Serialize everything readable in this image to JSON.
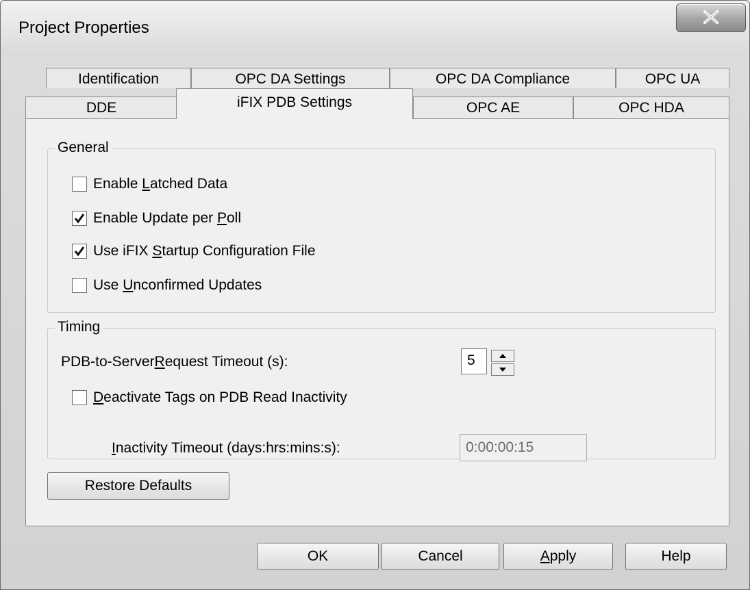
{
  "window": {
    "title": "Project Properties"
  },
  "tabs_row1": [
    "Identification",
    "OPC DA Settings",
    "OPC DA Compliance",
    "OPC UA"
  ],
  "tabs_row2": [
    "DDE",
    "iFIX PDB Settings",
    "OPC AE",
    "OPC HDA"
  ],
  "active_tab": "iFIX PDB Settings",
  "general": {
    "legend": "General",
    "options": [
      {
        "pre": "Enable ",
        "key": "L",
        "post": "atched Data",
        "checked": false
      },
      {
        "pre": "Enable Update per ",
        "key": "P",
        "post": "oll",
        "checked": true
      },
      {
        "pre": "Use iFIX ",
        "key": "S",
        "post": "tartup Configuration File",
        "checked": true
      },
      {
        "pre": "Use ",
        "key": "U",
        "post": "nconfirmed Updates",
        "checked": false
      }
    ]
  },
  "timing": {
    "legend": "Timing",
    "request_timeout": {
      "pre": "PDB-to-Server ",
      "key": "R",
      "post": "equest Timeout (s):",
      "value": "5"
    },
    "deactivate": {
      "pre": "",
      "key": "D",
      "post": "eactivate Tags on PDB Read Inactivity",
      "checked": false
    },
    "inactivity": {
      "pre": "",
      "key": "I",
      "post": "nactivity Timeout (days:hrs:mins:s):",
      "value": "0:00:00:15"
    }
  },
  "buttons": {
    "restore": "Restore Defaults",
    "ok": "OK",
    "cancel": "Cancel",
    "apply_key": "A",
    "apply_rest": "pply",
    "help": "Help"
  },
  "icons": {
    "close": "close-icon",
    "check": "check-icon",
    "spin_up": "arrow-up-icon",
    "spin_down": "arrow-down-icon"
  }
}
